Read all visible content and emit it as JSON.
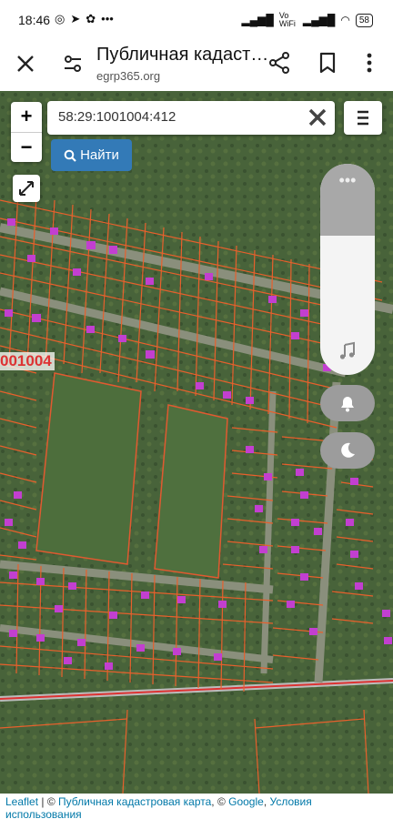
{
  "statusbar": {
    "time": "18:46",
    "network": "Vo WiFi",
    "battery": "58"
  },
  "appbar": {
    "title": "Публичная кадаст…",
    "url": "egrp365.org"
  },
  "map": {
    "search_value": "58:29:1001004:412",
    "find_label": "Найти",
    "zoom_in": "+",
    "zoom_out": "−",
    "parcel_label": "001004"
  },
  "volume_panel": {
    "dots": "•••",
    "level_fraction": 0.66
  },
  "attribution": {
    "leaflet": "Leaflet",
    "sep1": " | © ",
    "cadastral": "Публичная кадастровая карта",
    "sep2": ", © ",
    "google": "Google",
    "sep3": ", ",
    "terms": "Условия использования"
  }
}
